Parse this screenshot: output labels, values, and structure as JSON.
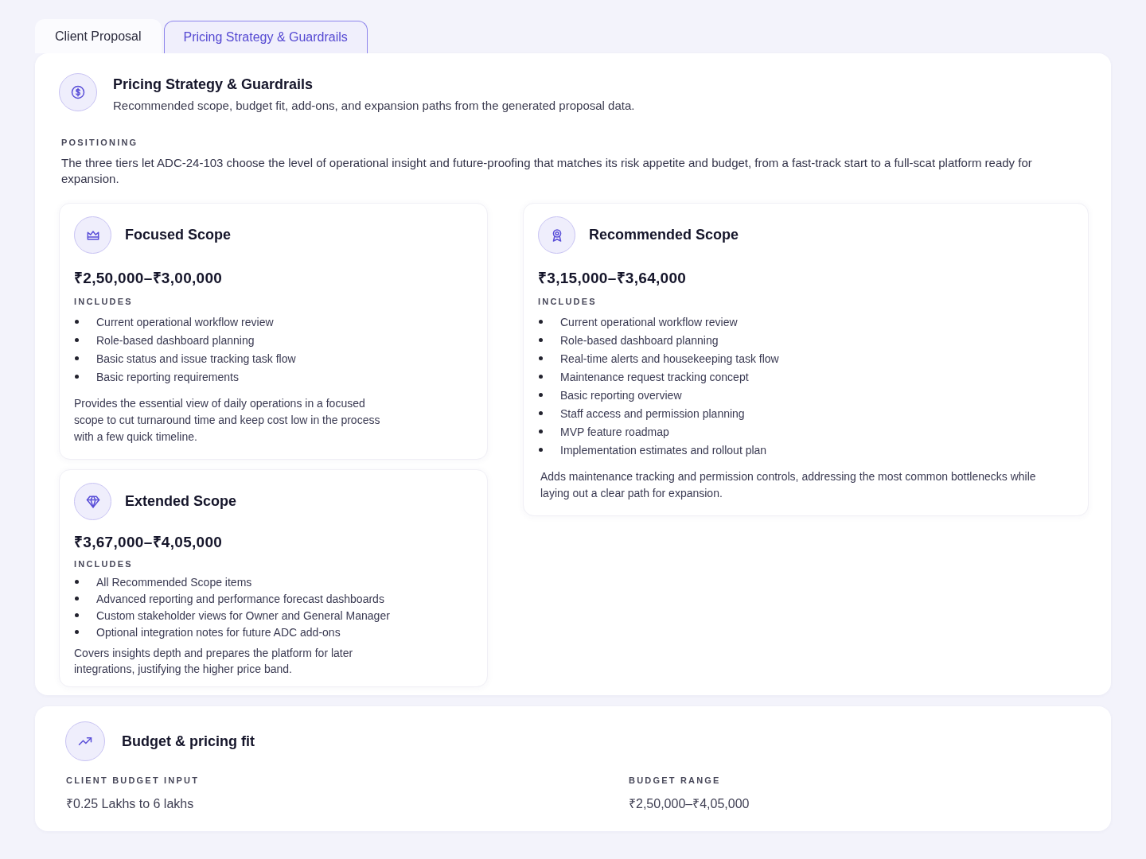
{
  "tabs": [
    {
      "label": "Client Proposal",
      "selected": false
    },
    {
      "label": "Pricing Strategy & Guardrails",
      "selected": true
    }
  ],
  "header": {
    "title": "Pricing Strategy & Guardrails",
    "subtitle": "Recommended scope, budget fit, add-ons, and expansion paths from the generated proposal data."
  },
  "positioning": {
    "label": "POSITIONING",
    "text": "The three tiers let ADC-24-103 choose the level of operational insight and future-proofing that matches its risk appetite and budget, from a fast-track start to a full-scat platform ready for expansion."
  },
  "tiers": [
    {
      "title": "Focused Scope",
      "price": "₹2,50,000–₹3,00,000",
      "includes_label": "INCLUDES",
      "items": [
        "Current operational workflow review",
        "Role-based dashboard planning",
        "Basic status and issue tracking task flow",
        "Basic reporting requirements"
      ],
      "description": "Provides the essential view of daily operations in a focused scope to cut turnaround time and keep cost low in the process with a few quick timeline."
    },
    {
      "title": "Recommended Scope",
      "price": "₹3,15,000–₹3,64,000",
      "includes_label": "INCLUDES",
      "items": [
        "Current operational workflow review",
        "Role-based dashboard planning",
        "Real-time alerts and housekeeping task flow",
        "Maintenance request tracking concept",
        "Basic reporting overview",
        "Staff access and permission planning",
        "MVP feature roadmap",
        "Implementation estimates and rollout plan"
      ],
      "description": "Adds maintenance tracking and permission controls, addressing the most common bottlenecks while laying out a clear path for expansion."
    },
    {
      "title": "Extended Scope",
      "price": "₹3,67,000–₹4,05,000",
      "includes_label": "INCLUDES",
      "items": [
        "All Recommended Scope items",
        "Advanced reporting and performance forecast dashboards",
        "Custom stakeholder views for Owner and General Manager",
        "Optional integration notes for future ADC add-ons"
      ],
      "description": "Covers insights depth and prepares the platform for later integrations, justifying the higher price band."
    }
  ],
  "budget": {
    "title": "Budget & pricing fit",
    "fields": [
      {
        "label": "CLIENT BUDGET INPUT",
        "value": "₹0.25 Lakhs to 6 lakhs"
      },
      {
        "label": "BUDGET RANGE",
        "value": "₹2,50,000–₹4,05,000"
      }
    ]
  }
}
